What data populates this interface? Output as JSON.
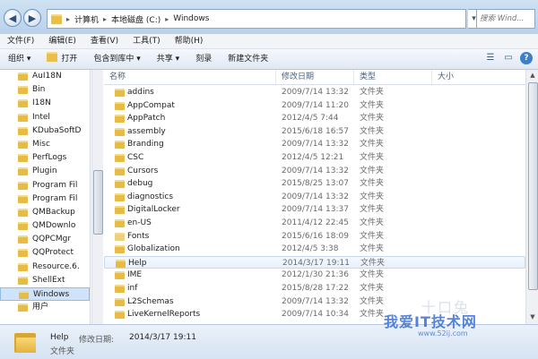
{
  "address": {
    "crumbs": [
      "计算机",
      "本地磁盘 (C:)",
      "Windows"
    ],
    "search_placeholder": "搜索 Wind..."
  },
  "menu": [
    "文件(F)",
    "编辑(E)",
    "查看(V)",
    "工具(T)",
    "帮助(H)"
  ],
  "toolbar": {
    "organize": "组织 ▾",
    "open": "打开",
    "include_library": "包含到库中 ▾",
    "share": "共享 ▾",
    "burn": "刻录",
    "new_folder": "新建文件夹"
  },
  "nav": {
    "items": [
      "AuI18N",
      "Bin",
      "I18N",
      "Intel",
      "KDubaSoftD",
      "Misc",
      "PerfLogs",
      "Plugin",
      "Program Fil",
      "Program Fil",
      "QMBackup",
      "QMDownlo",
      "QQPCMgr",
      "QQProtect",
      "Resource.6.",
      "ShellExt",
      "Windows",
      "用户"
    ],
    "selected_index": 16
  },
  "columns": {
    "name": "名称",
    "date": "修改日期",
    "type": "类型",
    "size": "大小"
  },
  "files": [
    {
      "name": "addins",
      "date": "2009/7/14 13:32",
      "type": "文件夹"
    },
    {
      "name": "AppCompat",
      "date": "2009/7/14 11:20",
      "type": "文件夹"
    },
    {
      "name": "AppPatch",
      "date": "2012/4/5 7:44",
      "type": "文件夹"
    },
    {
      "name": "assembly",
      "date": "2015/6/18 16:57",
      "type": "文件夹"
    },
    {
      "name": "Branding",
      "date": "2009/7/14 13:32",
      "type": "文件夹"
    },
    {
      "name": "CSC",
      "date": "2012/4/5 12:21",
      "type": "文件夹"
    },
    {
      "name": "Cursors",
      "date": "2009/7/14 13:32",
      "type": "文件夹"
    },
    {
      "name": "debug",
      "date": "2015/8/25 13:07",
      "type": "文件夹"
    },
    {
      "name": "diagnostics",
      "date": "2009/7/14 13:32",
      "type": "文件夹"
    },
    {
      "name": "DigitalLocker",
      "date": "2009/7/14 13:37",
      "type": "文件夹"
    },
    {
      "name": "en-US",
      "date": "2011/4/12 22:45",
      "type": "文件夹"
    },
    {
      "name": "Fonts",
      "date": "2015/6/16 18:09",
      "type": "文件夹"
    },
    {
      "name": "Globalization",
      "date": "2012/4/5 3:38",
      "type": "文件夹"
    },
    {
      "name": "Help",
      "date": "2014/3/17 19:11",
      "type": "文件夹"
    },
    {
      "name": "IME",
      "date": "2012/1/30 21:36",
      "type": "文件夹"
    },
    {
      "name": "inf",
      "date": "2015/8/28 17:22",
      "type": "文件夹"
    },
    {
      "name": "L2Schemas",
      "date": "2009/7/14 13:32",
      "type": "文件夹"
    },
    {
      "name": "LiveKernelReports",
      "date": "2009/7/14 10:34",
      "type": "文件夹"
    }
  ],
  "hover_index": 13,
  "details": {
    "name": "Help",
    "date_label": "修改日期:",
    "date": "2014/3/17 19:11",
    "type": "文件夹"
  },
  "watermark": {
    "text": "我爱IT技术网",
    "url": "www.52ij.com",
    "faint": "十口兔"
  }
}
